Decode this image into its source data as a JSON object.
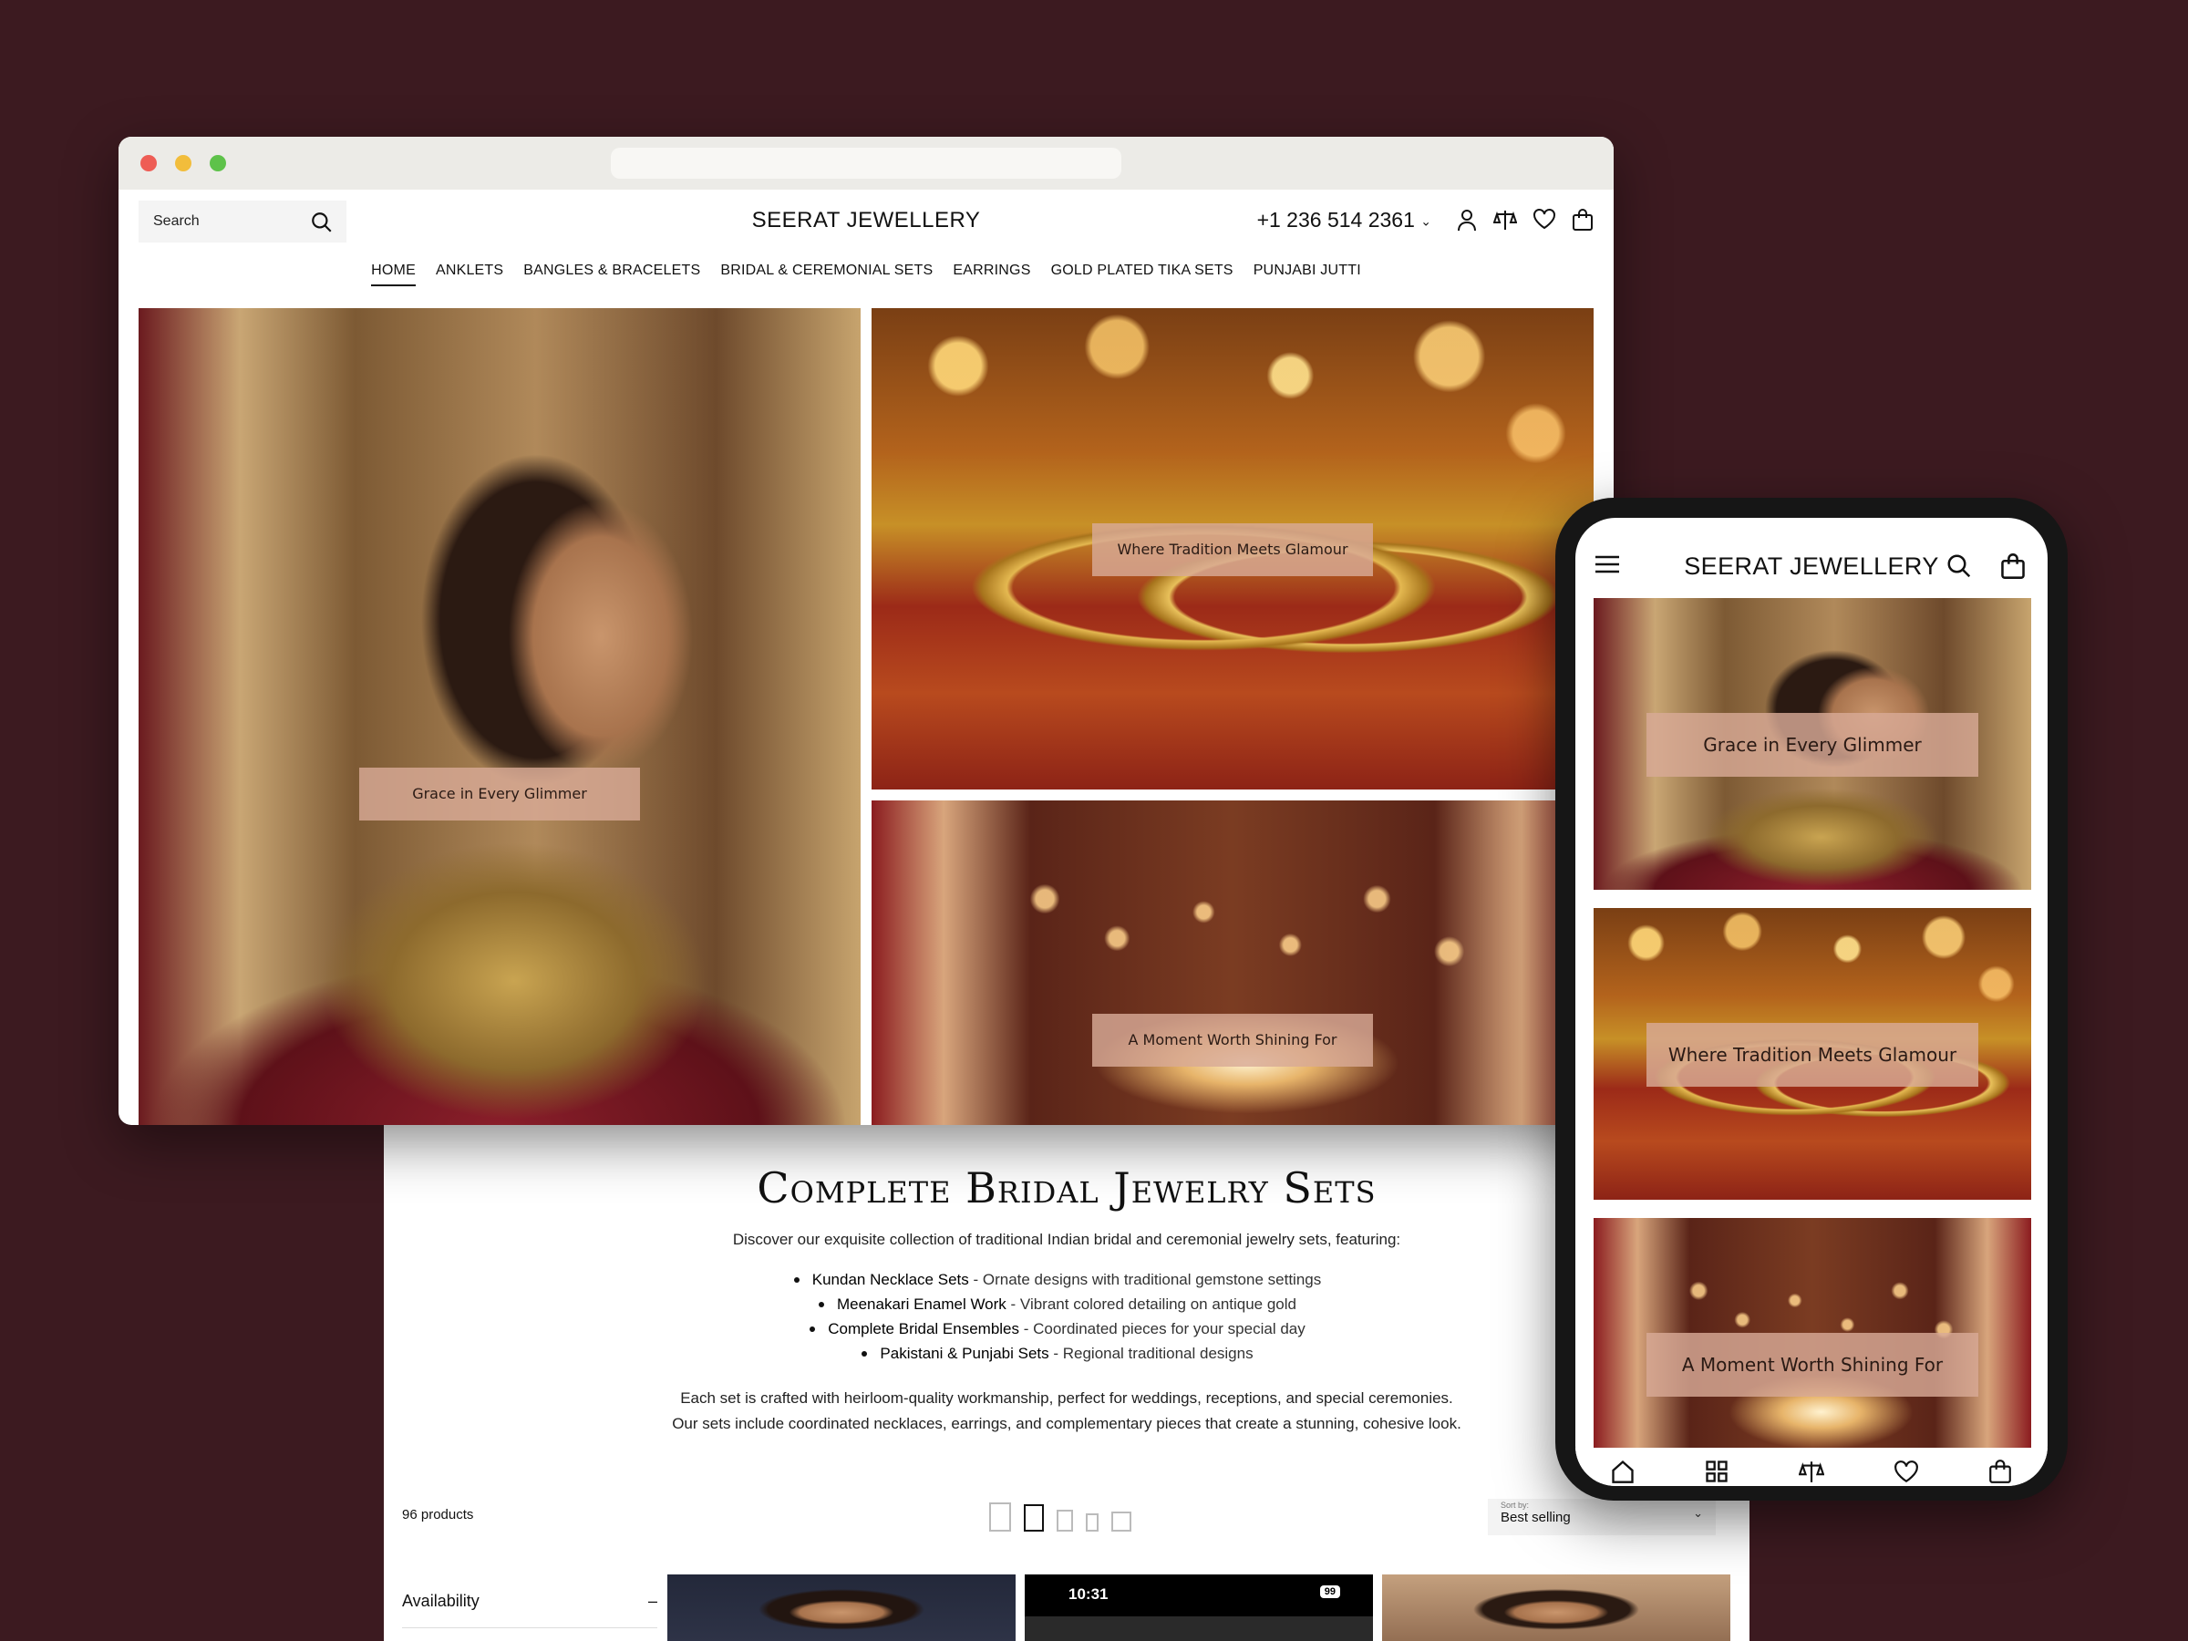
{
  "browser": {
    "search": {
      "placeholder": "Search"
    },
    "brand": "SEERAT JEWELLERY",
    "phone": "+1 236 514 2361",
    "nav": [
      "HOME",
      "ANKLETS",
      "BANGLES & BRACELETS",
      "BRIDAL & CEREMONIAL SETS",
      "EARRINGS",
      "GOLD PLATED TIKA SETS",
      "PUNJABI JUTTI"
    ],
    "hero": {
      "left_caption": "Grace in Every Glimmer",
      "top_right_caption": "Where Tradition Meets Glamour",
      "bottom_right_caption": "A Moment Worth Shining For"
    },
    "header_icons": [
      "account-icon",
      "compare-icon",
      "wishlist-icon",
      "cart-icon"
    ]
  },
  "collection": {
    "title": "Complete Bridal Jewelry Sets",
    "intro": "Discover our exquisite collection of traditional Indian bridal and ceremonial jewelry sets, featuring:",
    "items": [
      {
        "name": "Kundan Necklace Sets",
        "desc": " - Ornate designs with traditional gemstone settings"
      },
      {
        "name": "Meenakari Enamel Work",
        "desc": " - Vibrant colored detailing on antique gold"
      },
      {
        "name": "Complete Bridal Ensembles",
        "desc": " - Coordinated pieces for your special day"
      },
      {
        "name": "Pakistani & Punjabi Sets",
        "desc": " - Regional traditional designs"
      }
    ],
    "outro_1": "Each set is crafted with heirloom-quality workmanship, perfect for weddings, receptions, and special ceremonies.",
    "outro_2": "Our sets include coordinated necklaces, earrings, and complementary pieces that create a stunning, cohesive look.",
    "products_count": "96 products",
    "sort_label": "Sort by:",
    "sort_value": "Best selling",
    "filter_availability": "Availability",
    "phone_time": "10:31",
    "phone_battery": "99"
  },
  "mobile": {
    "brand": "SEERAT JEWELLERY",
    "captions": [
      "Grace in Every Glimmer",
      "Where Tradition Meets Glamour",
      "A Moment Worth Shining For"
    ],
    "bottom_nav_icons": [
      "home-icon",
      "grid-icon",
      "compare-icon",
      "wishlist-icon",
      "cart-icon"
    ]
  },
  "colors": {
    "background": "#3c1a20",
    "caption_bg": "#d8aa96"
  }
}
